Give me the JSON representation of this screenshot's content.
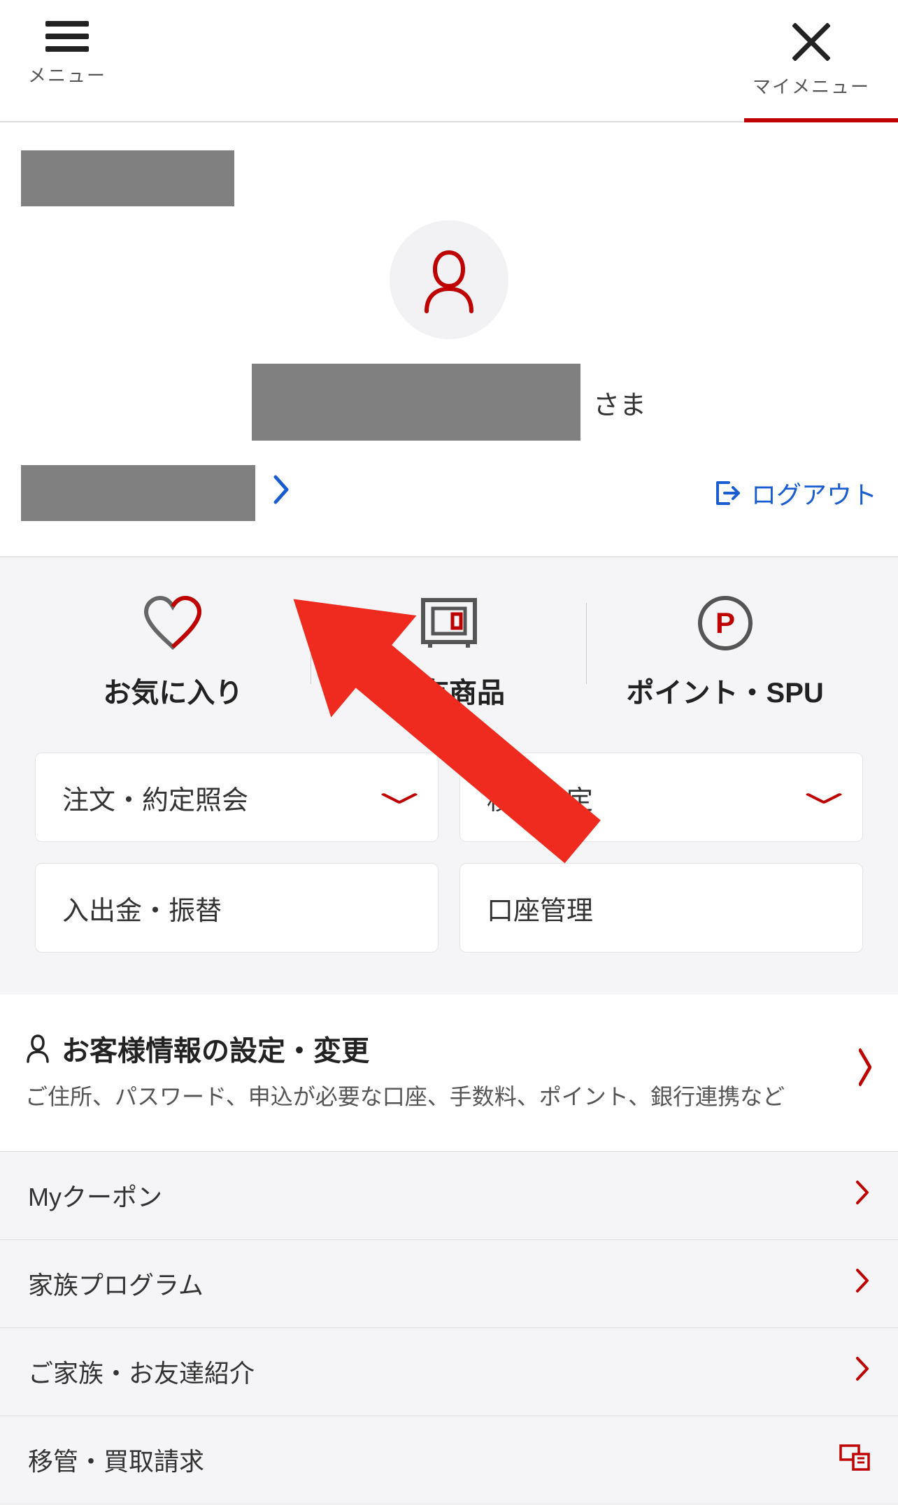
{
  "header": {
    "menu_label": "メニュー",
    "mymenu_label": "マイメニュー"
  },
  "profile": {
    "sama": "さま",
    "logout": "ログアウト"
  },
  "quick": {
    "favorites": "お気に入り",
    "holdings": "保有商品",
    "points_spu": "ポイント・SPU"
  },
  "cards": {
    "orders": "注文・約定照会",
    "tsumitate": "積立設定",
    "cash": "入出金・振替",
    "account": "口座管理"
  },
  "settings": {
    "title": "お客様情報の設定・変更",
    "subtitle": "ご住所、パスワード、申込が必要な口座、手数料、ポイント、銀行連携など"
  },
  "list": {
    "my_coupon": "Myクーポン",
    "family_program": "家族プログラム",
    "referral": "ご家族・お友達紹介",
    "transfer": "移管・買取請求"
  }
}
